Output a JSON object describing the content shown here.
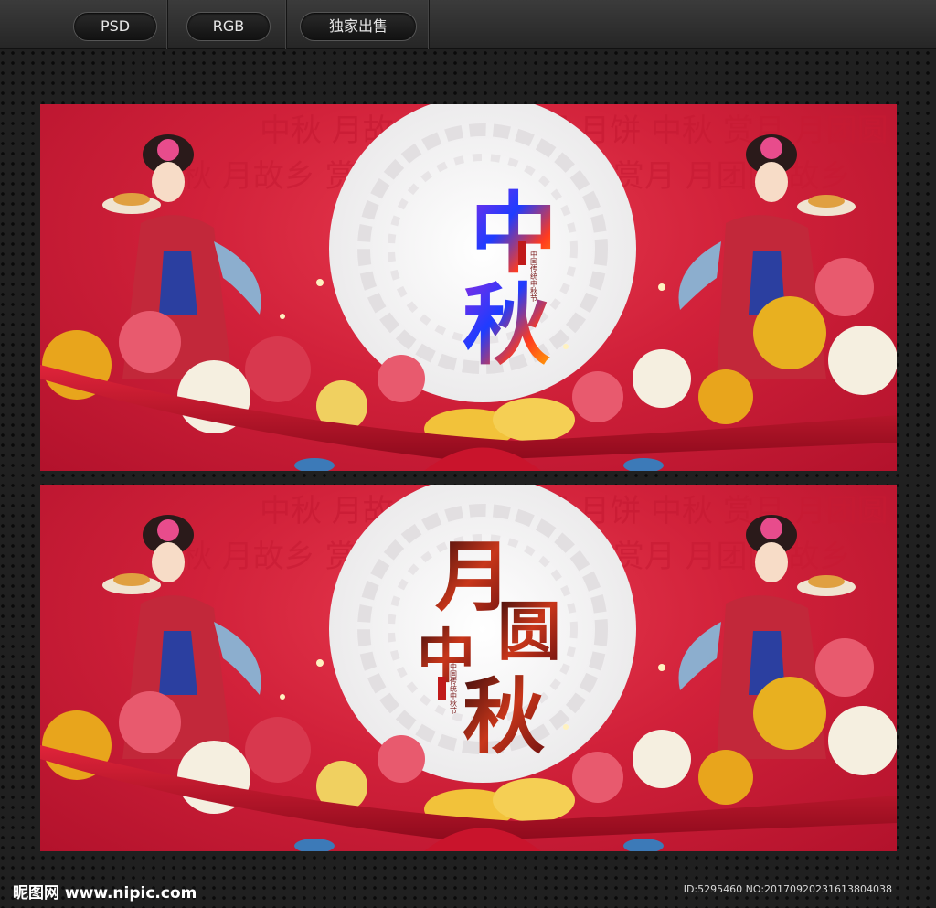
{
  "toolbar": {
    "tabs": [
      {
        "label": "PSD"
      },
      {
        "label": "RGB"
      },
      {
        "label": "独家出售"
      }
    ]
  },
  "banner_top": {
    "title_chars": [
      "中",
      "秋"
    ],
    "bg_words": "中秋 月故乡 赏月 团圆 月饼 中秋 赏月 月团圆 故乡",
    "caption": "中国传统中秋节",
    "colors": {
      "red": "#d1213a",
      "moon": "#f3f1f2"
    }
  },
  "banner_bottom": {
    "title_chars": [
      "月",
      "圆",
      "中",
      "秋"
    ],
    "bg_words": "中秋 月故乡 赏月 团圆 月饼 中秋 赏月 月团圆 故乡",
    "caption": "中国传统中秋节",
    "colors": {
      "red": "#d1213a",
      "moon": "#f3f1f2"
    }
  },
  "footer": {
    "logo": "昵图网 www.nipic.com",
    "id_text": "ID:5295460 NO:20170920231613804038"
  }
}
